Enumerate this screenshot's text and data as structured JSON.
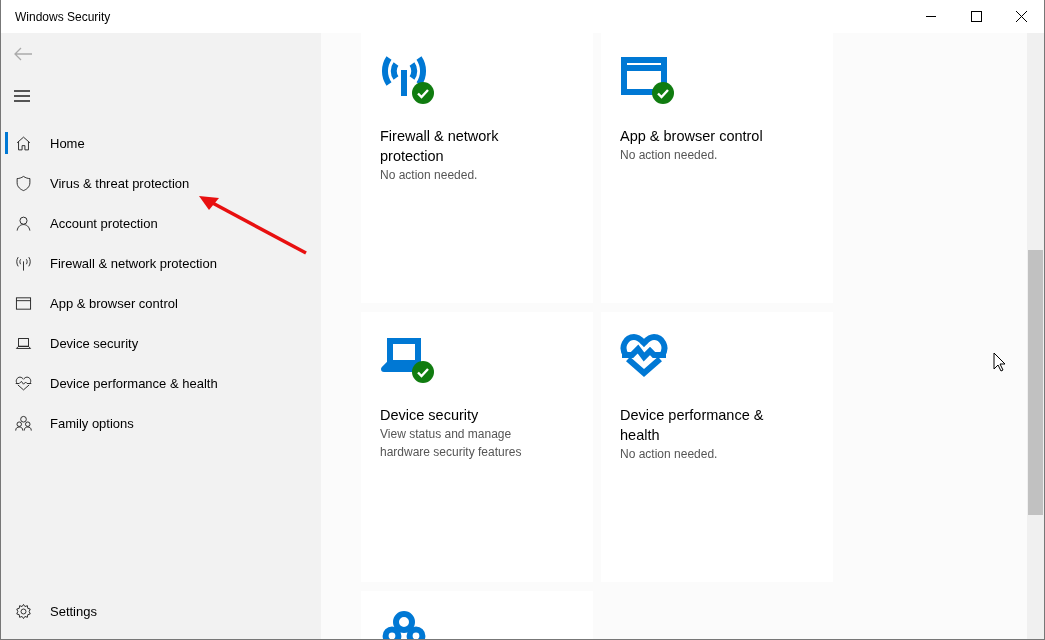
{
  "window": {
    "title": "Windows Security"
  },
  "sidebar": {
    "items": [
      {
        "label": "Home",
        "kind": "home",
        "selected": true
      },
      {
        "label": "Virus & threat protection",
        "kind": "shield",
        "selected": false
      },
      {
        "label": "Account protection",
        "kind": "person",
        "selected": false
      },
      {
        "label": "Firewall & network protection",
        "kind": "antenna",
        "selected": false
      },
      {
        "label": "App & browser control",
        "kind": "browser",
        "selected": false
      },
      {
        "label": "Device security",
        "kind": "laptop",
        "selected": false
      },
      {
        "label": "Device performance & health",
        "kind": "heart",
        "selected": false
      },
      {
        "label": "Family options",
        "kind": "family",
        "selected": false
      }
    ],
    "settings": {
      "label": "Settings"
    }
  },
  "cards": [
    {
      "kind": "antenna",
      "checked": true,
      "title": "Firewall & network protection",
      "status": "No action needed."
    },
    {
      "kind": "browser",
      "checked": true,
      "title": "App & browser control",
      "status": "No action needed."
    },
    {
      "kind": "laptop",
      "checked": true,
      "title": "Device security",
      "status": "View status and manage hardware security features"
    },
    {
      "kind": "heart",
      "checked": false,
      "title": "Device performance & health",
      "status": "No action needed."
    },
    {
      "kind": "family"
    }
  ]
}
